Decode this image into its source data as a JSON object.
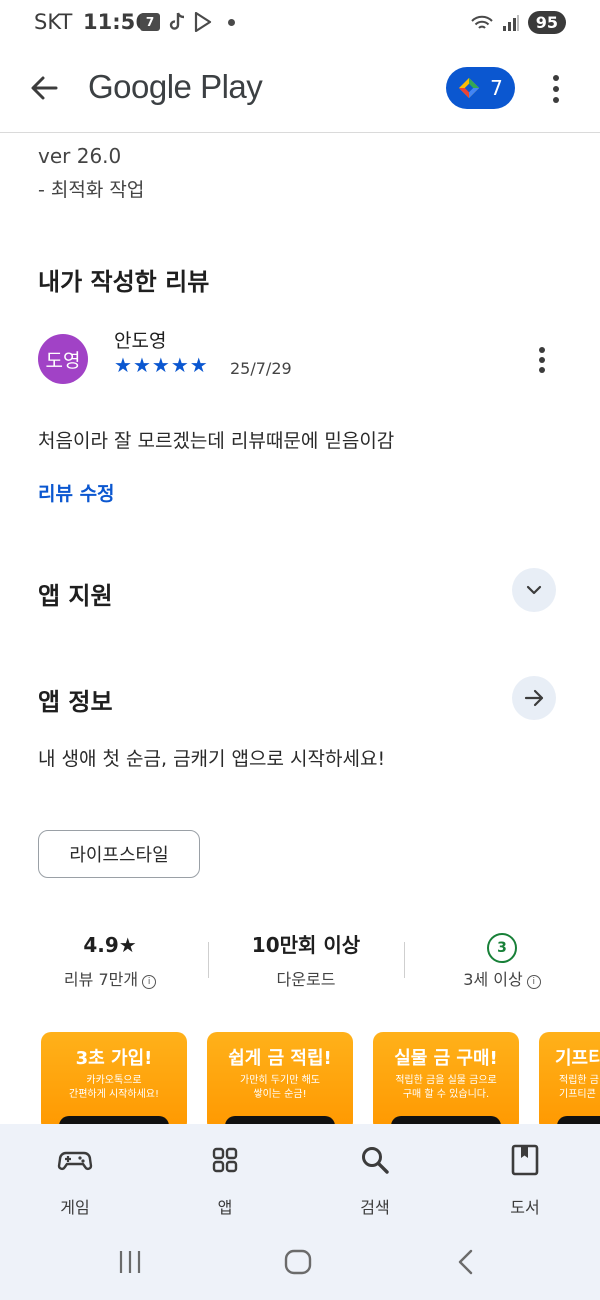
{
  "status_bar": {
    "carrier": "SKT",
    "time": "11:56",
    "battery": "95"
  },
  "app_bar": {
    "title": "Google Play",
    "points": "7"
  },
  "whats_new": {
    "version": "ver 26.0",
    "note": "- 최적화 작업"
  },
  "my_review": {
    "section_title": "내가 작성한 리뷰",
    "avatar_text": "도영",
    "reviewer": "안도영",
    "rating": 5,
    "date": "25/7/29",
    "text": "처음이라 잘 모르겠는데 리뷰때문에 믿음이감",
    "edit_label": "리뷰 수정"
  },
  "app_support": {
    "title": "앱 지원"
  },
  "app_info": {
    "title": "앱 정보",
    "description": "내 생애 첫 순금, 금캐기 앱으로 시작하세요!",
    "category_chip": "라이프스타일"
  },
  "stats": [
    {
      "value": "4.9★",
      "label": "리뷰 7만개"
    },
    {
      "value": "10만회 이상",
      "label": "다운로드"
    },
    {
      "value": "3",
      "label": "3세 이상"
    }
  ],
  "screenshots": [
    {
      "headline": "3초 가입!",
      "sub1": "카카오톡으로",
      "sub2": "간편하게 시작하세요!"
    },
    {
      "headline": "쉽게 금 적립!",
      "sub1": "가만히 두기만 해도",
      "sub2": "쌓이는 순금!"
    },
    {
      "headline": "실물 금 구매!",
      "sub1": "적립한 금을 실물 금으로",
      "sub2": "구매 할 수 있습니다."
    },
    {
      "headline": "기프티",
      "sub1": "적립한 금",
      "sub2": "기프티콘"
    }
  ],
  "bottom_nav": [
    {
      "label": "게임",
      "icon": "gamepad-icon"
    },
    {
      "label": "앱",
      "icon": "apps-grid-icon"
    },
    {
      "label": "검색",
      "icon": "search-icon"
    },
    {
      "label": "도서",
      "icon": "book-icon"
    }
  ],
  "colors": {
    "accent": "#0b57d0",
    "avatar": "#a142c6",
    "age_badge": "#188038",
    "nav_bg": "#eef2f9",
    "screenshot_bg": "#ff9800"
  }
}
